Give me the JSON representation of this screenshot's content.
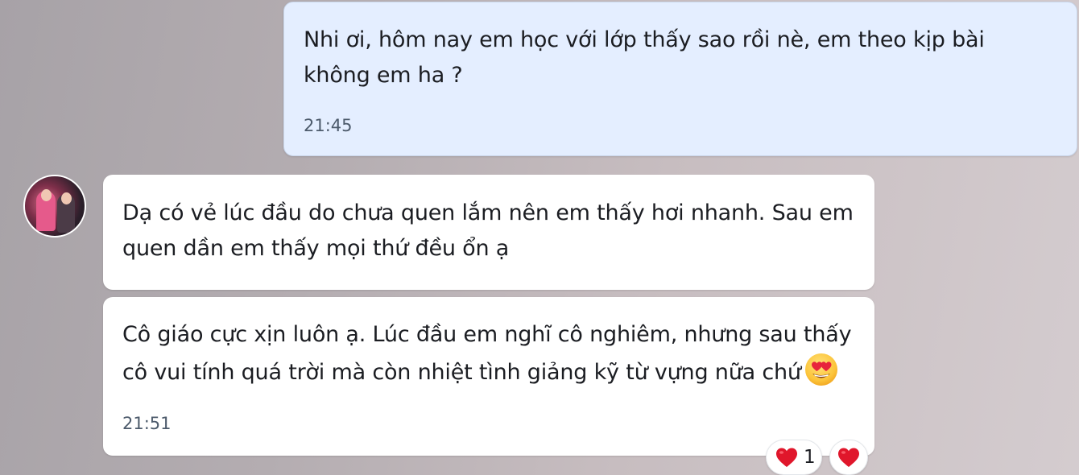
{
  "messages": {
    "outgoing": {
      "text": "Nhi ơi, hôm nay em học với lớp thấy sao rồi nè, em theo kịp bài không em ha ?",
      "time": "21:45"
    },
    "incoming": [
      {
        "text": "Dạ có vẻ lúc đầu do chưa quen lắm nên em thấy hơi nhanh. Sau em quen dần em thấy mọi thứ đều ổn ạ"
      },
      {
        "text": "Cô giáo cực xịn luôn ạ. Lúc đầu em nghĩ cô nghiêm, nhưng sau thấy cô vui tính quá trời mà còn nhiệt tình giảng kỹ từ vựng nữa chứ",
        "emoji": "heart-eyes-emoji",
        "time": "21:51"
      }
    ]
  },
  "reactions": {
    "heart": {
      "icon": "heart-icon",
      "count": "1"
    },
    "add_reaction": {
      "icon": "heart-icon"
    }
  },
  "colors": {
    "outgoing_bubble": "#e4eeff",
    "incoming_bubble": "#ffffff",
    "timestamp": "#4c5a6b",
    "heart": "#e0162b"
  }
}
